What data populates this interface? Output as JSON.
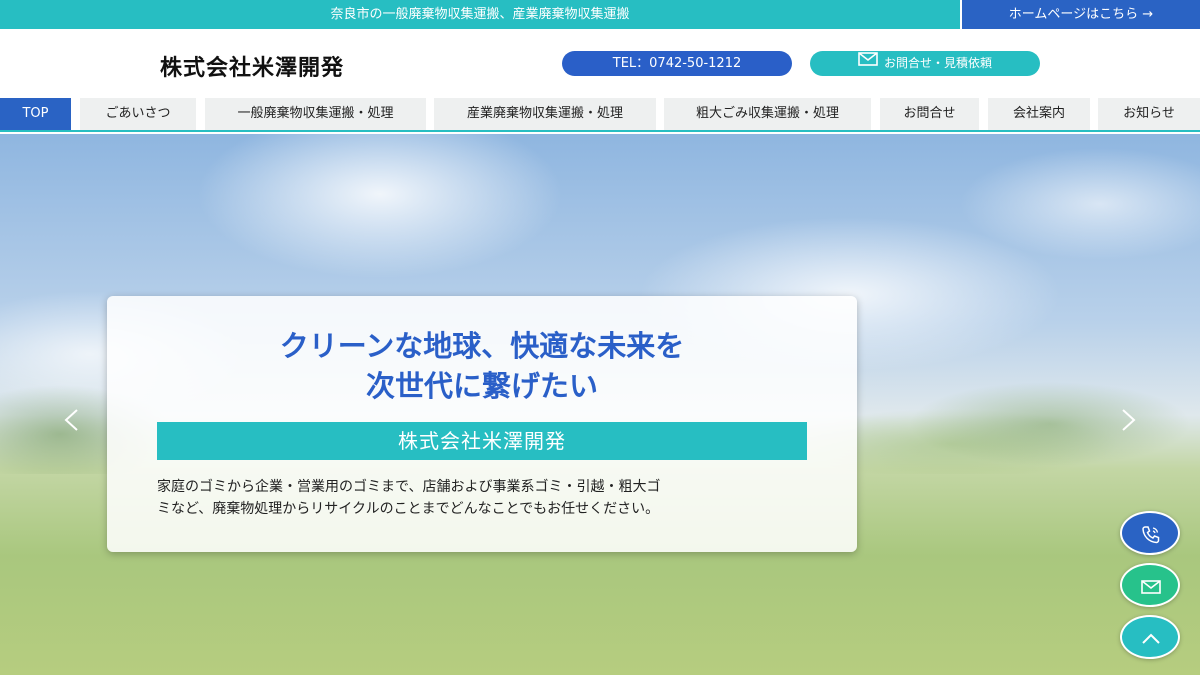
{
  "topbar": {
    "tagline": "奈良市の一般廃棄物収集運搬、産業廃棄物収集運搬",
    "home_link": "ホームページはこちら →"
  },
  "header": {
    "logo": "株式会社米澤開発",
    "tel_label": "TEL：0742-50-1212",
    "contact_label": "お問合せ・見積依頼"
  },
  "nav": {
    "items": [
      {
        "label": "TOP"
      },
      {
        "label": "ごあいさつ"
      },
      {
        "label": "一般廃棄物収集運搬・処理"
      },
      {
        "label": "産業廃棄物収集運搬・処理"
      },
      {
        "label": "粗大ごみ収集運搬・処理"
      },
      {
        "label": "お問合せ"
      },
      {
        "label": "会社案内"
      },
      {
        "label": "お知らせ"
      }
    ]
  },
  "hero": {
    "headline_line1": "クリーンな地球、快適な未来を",
    "headline_line2": "次世代に繋げたい",
    "company": "株式会社米澤開発",
    "desc_line1": "家庭のゴミから企業・営業用のゴミまで、店舗および事業系ゴミ・引越・粗大ゴ",
    "desc_line2": "ミなど、廃棄物処理からリサイクルのことまでどんなことでもお任せください。"
  },
  "icons": {
    "prev": "chevron-left-icon",
    "next": "chevron-right-icon",
    "phone": "phone-icon",
    "mail": "mail-icon",
    "top": "chevron-up-icon"
  },
  "colors": {
    "teal": "#27bec2",
    "blue": "#2a63c4",
    "green": "#27c28b"
  }
}
